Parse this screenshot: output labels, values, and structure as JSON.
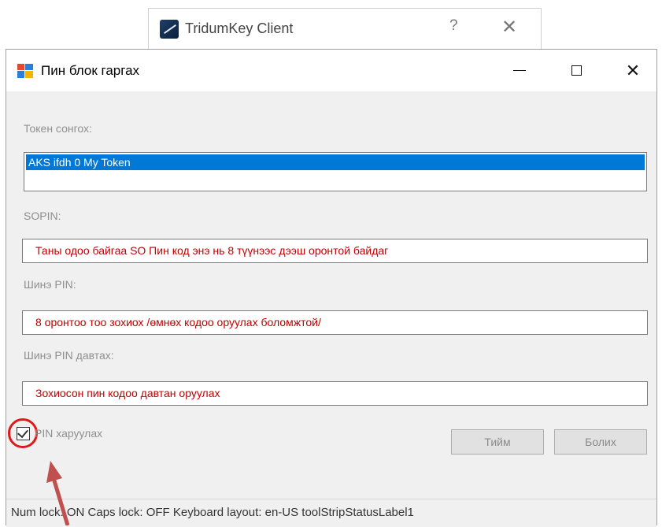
{
  "background_window": {
    "title": "TridumKey Client",
    "help_label": "?",
    "close_label": "✕"
  },
  "dialog": {
    "title": "Пин блок гаргах",
    "controls": {
      "minimize": "—",
      "maximize": "☐",
      "close": "✕"
    },
    "token": {
      "label": "Токен сонгох:",
      "items": [
        "AKS ifdh 0 My Token"
      ],
      "selected_index": 0
    },
    "sopin": {
      "label": "SOPIN:",
      "value": "Таны одоо байгаа SO Пин код энэ нь 8 түүнээс дээш оронтой байдаг"
    },
    "new_pin": {
      "label": "Шинэ PIN:",
      "value": "8 оронтоо тоо зохиох /өмнөх кодоо оруулах боломжтой/"
    },
    "repeat_pin": {
      "label": "Шинэ PIN давтах:",
      "value": "Зохиосон пин кодоо давтан оруулах"
    },
    "show_pin": {
      "label": "PIN харуулах",
      "checked": true
    },
    "buttons": {
      "ok": "Тийм",
      "cancel": "Болих"
    },
    "status": "Num lock: ON  Caps lock: OFF  Keyboard layout: en-US  toolStripStatusLabel1"
  },
  "annotation_color": "#e11818",
  "accent": "#0078d7",
  "hint_color": "#c00000",
  "icons": [
    "tridumkey-app-icon",
    "dialog-app-icon",
    "help-icon",
    "close-icon",
    "minimize-icon",
    "maximize-icon",
    "checkmark-icon",
    "annotation-arrow"
  ]
}
